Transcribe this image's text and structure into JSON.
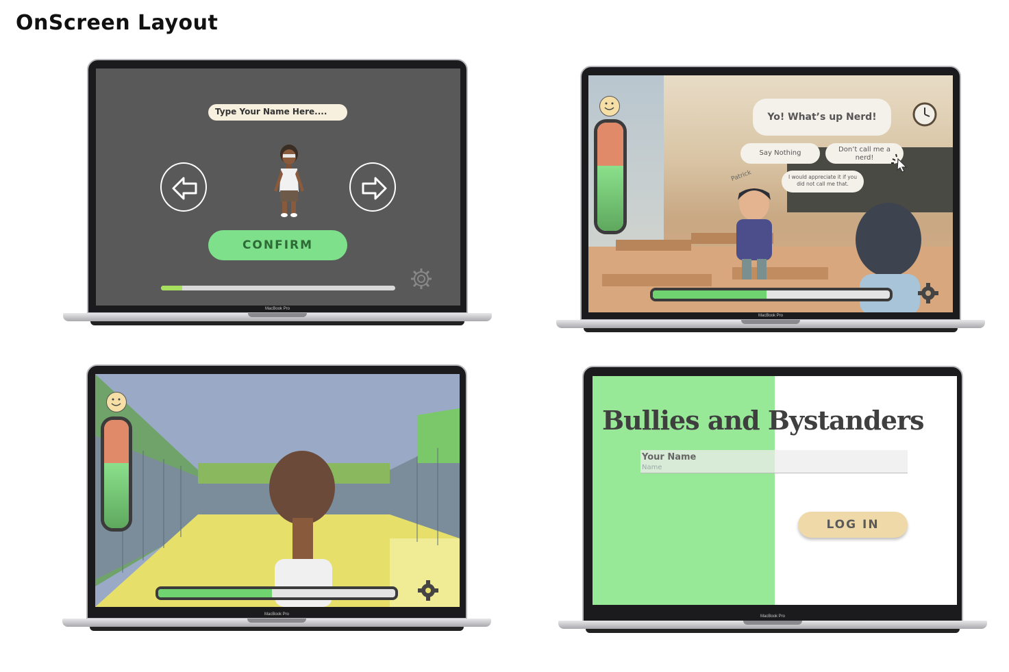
{
  "page": {
    "title": "OnScreen Layout"
  },
  "laptop_label": "MacBook Pro",
  "screen1": {
    "name_placeholder": "Type Your Name Here....",
    "prev_icon": "arrow-left-icon",
    "next_icon": "arrow-right-icon",
    "confirm_label": "CONFIRM",
    "settings_icon": "gear-icon",
    "progress": 0.09
  },
  "screen2": {
    "npc_line": "Yo! What’s up Nerd!",
    "choices": [
      "Say Nothing",
      "Don’t call me a nerd!",
      "I would appreciate it if you did not call me that."
    ],
    "npc_name": "Patrick",
    "mood_icon": "smiley-icon",
    "clock_icon": "clock-icon",
    "settings_icon": "gear-icon",
    "progress": 0.48
  },
  "screen3": {
    "mood_icon": "smiley-icon",
    "settings_icon": "gear-icon",
    "progress": 0.48
  },
  "screen4": {
    "game_title": "Bullies and Bystanders",
    "name_label": "Your Name",
    "name_placeholder": "Name",
    "login_label": "LOG IN"
  },
  "colors": {
    "confirm_green": "#7ee08a",
    "login_tan": "#f0d9a8",
    "login_green_panel": "#97e897",
    "mood_red": "#e08a6a",
    "mood_green": "#72cf72"
  }
}
